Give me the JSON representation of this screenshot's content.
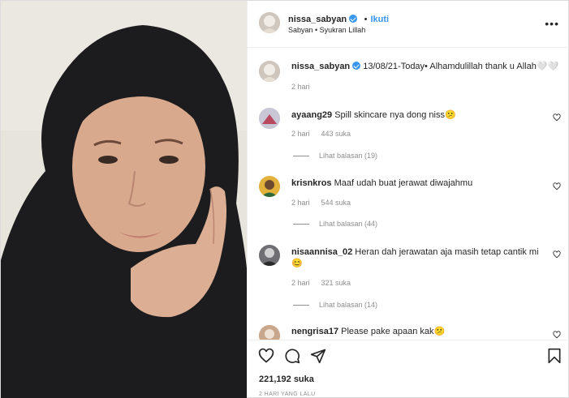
{
  "post": {
    "username": "nissa_sabyan",
    "follow_label": "Ikuti",
    "location": "Sabyan • Syukran Lillah",
    "caption": "13/08/21-Today• Alhamdulillah thank u Allah🤍🤍",
    "caption_time": "2 hari",
    "likes": "221,192 suka",
    "posted_ago": "2 HARI YANG LALU"
  },
  "comments": [
    {
      "username": "ayaang29",
      "text": "Spill skincare nya dong niss😕",
      "time": "2 hari",
      "likes": "443 suka",
      "replies": "Lihat balasan (19)"
    },
    {
      "username": "krisnkros",
      "text": "Maaf udah buat jerawat diwajahmu",
      "time": "2 hari",
      "likes": "544 suka",
      "replies": "Lihat balasan (44)"
    },
    {
      "username": "nisaannisa_02",
      "text": "Heran dah jerawatan aja masih tetap cantik mi",
      "text2": "😊",
      "time": "2 hari",
      "likes": "321 suka",
      "replies": "Lihat balasan (14)"
    },
    {
      "username": "nengrisa17",
      "text": "Please pake apaan kak😕"
    }
  ],
  "icons": {
    "heart": "heart-icon",
    "comment": "comment-icon",
    "share": "share-icon",
    "save": "bookmark-icon",
    "more": "more-options-icon",
    "verified": "verified-badge-icon"
  },
  "colors": {
    "link_blue": "#3897f0",
    "muted": "#8e8e8e",
    "border": "#efefef",
    "hijab": "#1c1c1e"
  }
}
